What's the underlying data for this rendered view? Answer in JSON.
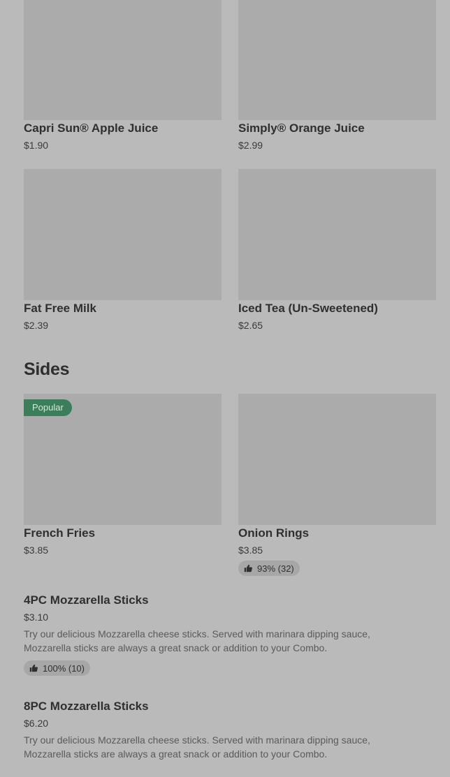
{
  "drinks": [
    {
      "name": "Capri Sun® Apple Juice",
      "price": "$1.90"
    },
    {
      "name": "Simply® Orange Juice",
      "price": "$2.99"
    },
    {
      "name": "Fat Free Milk",
      "price": "$2.39"
    },
    {
      "name": "Iced Tea (Un-Sweetened)",
      "price": "$2.65"
    }
  ],
  "sides_section": {
    "title": "Sides",
    "cards": [
      {
        "name": "French Fries",
        "price": "$3.85",
        "badge": "Popular"
      },
      {
        "name": "Onion Rings",
        "price": "$3.85",
        "rating": "93% (32)"
      }
    ],
    "list_items": [
      {
        "name": "4PC Mozzarella Sticks",
        "price": "$3.10",
        "description": "Try our delicious Mozzarella cheese sticks. Served with marinara dipping sauce, Mozzarella sticks are always a great snack or addition to your Combo.",
        "rating": "100% (10)"
      },
      {
        "name": "8PC Mozzarella Sticks",
        "price": "$6.20",
        "description": "Try our delicious Mozzarella cheese sticks. Served with marinara dipping sauce, Mozzarella sticks are always a great snack or addition to your Combo."
      }
    ]
  },
  "icons": {
    "rating": "thumbs-up-icon"
  },
  "colors": {
    "background": "#bababa",
    "image_placeholder": "#ababab",
    "popular_badge": "#3c7d5c"
  }
}
